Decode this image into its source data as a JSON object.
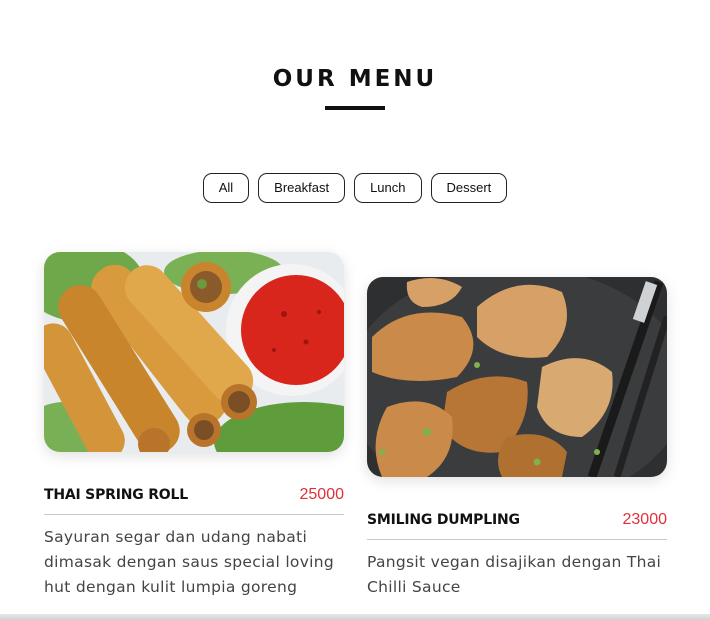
{
  "header": {
    "title": "OUR MENU"
  },
  "filters": [
    "All",
    "Breakfast",
    "Lunch",
    "Dessert"
  ],
  "colors": {
    "price": "#e0303a",
    "title": "#111111",
    "border": "#222222"
  },
  "menu": [
    {
      "name": "THAI SPRING ROLL",
      "price": "25000",
      "description": "Sayuran segar dan udang nabati dimasak dengan saus special loving hut dengan kulit lumpia goreng",
      "image": "spring-roll-photo"
    },
    {
      "name": "SMILING DUMPLING",
      "price": "23000",
      "description": "Pangsit vegan disajikan dengan Thai Chilli Sauce",
      "image": "dumpling-photo"
    }
  ]
}
